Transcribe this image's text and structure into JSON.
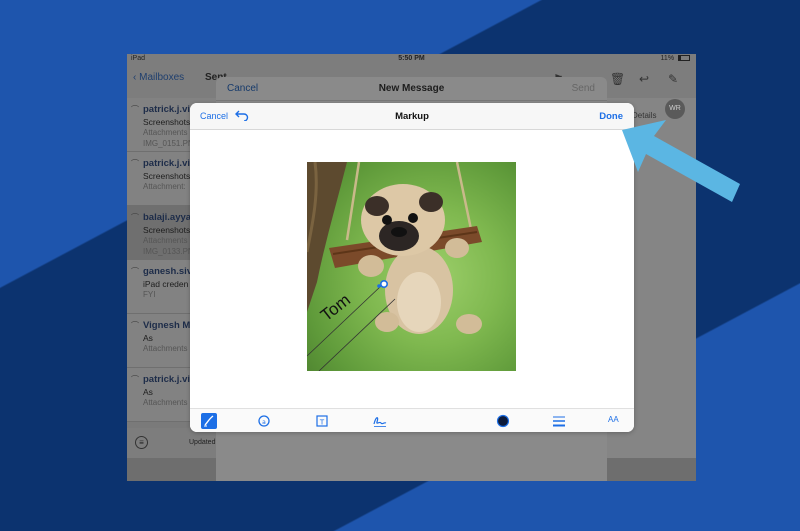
{
  "statusbar": {
    "device": "iPad",
    "time": "5:50 PM",
    "battery": "11%"
  },
  "mail_nav": {
    "back_label": "Mailboxes",
    "title": "Sent"
  },
  "mails": [
    {
      "from": "patrick.j.vi",
      "line2": "Screenshots",
      "line3": "Attachments",
      "line4": "IMG_0151.PN"
    },
    {
      "from": "patrick.j.vi",
      "line2": "Screenshots",
      "line3": "Attachment:",
      "line4": ""
    },
    {
      "from": "balaji.ayya",
      "line2": "Screenshots",
      "line3": "Attachments",
      "line4": "IMG_0133.PN"
    },
    {
      "from": "ganesh.siv",
      "line2": "iPad creden",
      "line3": "FYI",
      "line4": ""
    },
    {
      "from": "Vignesh M",
      "line2": "As",
      "line3": "Attachments",
      "line4": ""
    },
    {
      "from": "patrick.j.vi",
      "line2": "As",
      "line3": "Attachments",
      "line4": ""
    }
  ],
  "list_footer": {
    "status": "Updated"
  },
  "compose": {
    "cancel_label": "Cancel",
    "title": "New Message",
    "send_label": "Send"
  },
  "recipient": {
    "avatar_initials": "WR",
    "details_label": "Details"
  },
  "markup": {
    "cancel_label": "Cancel",
    "title": "Markup",
    "done_label": "Done",
    "annotation_text": "Tom",
    "text_tool_label": "AA"
  },
  "colors": {
    "accent": "#1d6fe6",
    "arrow": "#5bb6e3",
    "bg_dark": "#0c336f",
    "bg_light": "#1e55ad",
    "selected_color": "#0d1b3a"
  },
  "icons": [
    "undo-icon",
    "pen-icon",
    "magnifier-icon",
    "text-box-icon",
    "signature-icon",
    "color-dot-icon",
    "line-width-icon",
    "font-size-icon"
  ]
}
